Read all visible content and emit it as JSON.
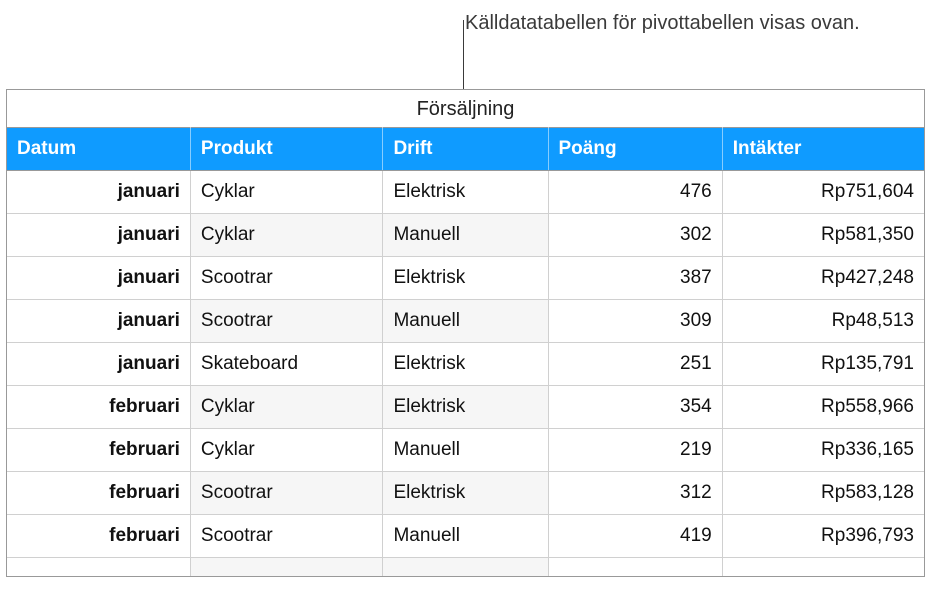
{
  "callout": "Källdatatabellen för pivottabellen visas ovan.",
  "table": {
    "caption": "Försäljning",
    "headers": {
      "datum": "Datum",
      "produkt": "Produkt",
      "drift": "Drift",
      "poang": "Poäng",
      "intakter": "Intäkter"
    },
    "rows": [
      {
        "datum": "januari",
        "produkt": "Cyklar",
        "drift": "Elektrisk",
        "poang": "476",
        "intakter": "Rp751,604",
        "shade_prod": false,
        "shade_drift": false
      },
      {
        "datum": "januari",
        "produkt": "Cyklar",
        "drift": "Manuell",
        "poang": "302",
        "intakter": "Rp581,350",
        "shade_prod": true,
        "shade_drift": true
      },
      {
        "datum": "januari",
        "produkt": "Scootrar",
        "drift": "Elektrisk",
        "poang": "387",
        "intakter": "Rp427,248",
        "shade_prod": false,
        "shade_drift": false
      },
      {
        "datum": "januari",
        "produkt": "Scootrar",
        "drift": "Manuell",
        "poang": "309",
        "intakter": "Rp48,513",
        "shade_prod": true,
        "shade_drift": true
      },
      {
        "datum": "januari",
        "produkt": "Skateboard",
        "drift": "Elektrisk",
        "poang": "251",
        "intakter": "Rp135,791",
        "shade_prod": false,
        "shade_drift": false
      },
      {
        "datum": "februari",
        "produkt": "Cyklar",
        "drift": "Elektrisk",
        "poang": "354",
        "intakter": "Rp558,966",
        "shade_prod": true,
        "shade_drift": true
      },
      {
        "datum": "februari",
        "produkt": "Cyklar",
        "drift": "Manuell",
        "poang": "219",
        "intakter": "Rp336,165",
        "shade_prod": false,
        "shade_drift": false
      },
      {
        "datum": "februari",
        "produkt": "Scootrar",
        "drift": "Elektrisk",
        "poang": "312",
        "intakter": "Rp583,128",
        "shade_prod": true,
        "shade_drift": true
      },
      {
        "datum": "februari",
        "produkt": "Scootrar",
        "drift": "Manuell",
        "poang": "419",
        "intakter": "Rp396,793",
        "shade_prod": false,
        "shade_drift": false
      }
    ]
  }
}
